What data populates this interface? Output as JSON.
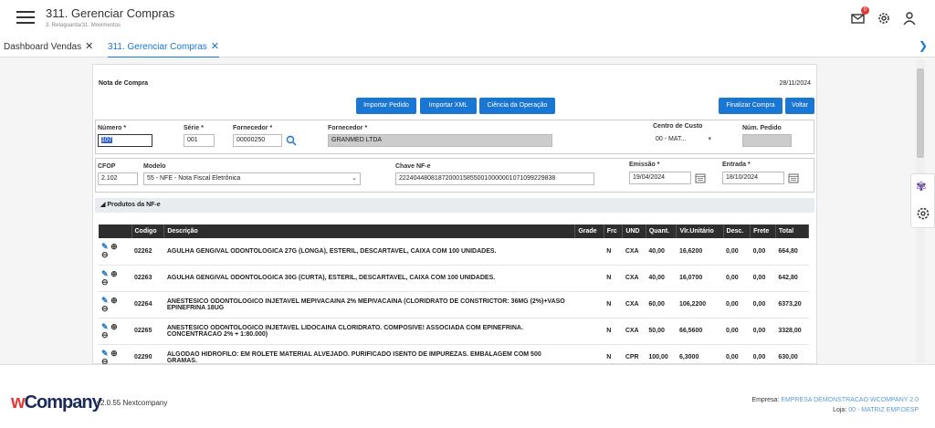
{
  "header": {
    "title": "311. Gerenciar Compras",
    "breadcrumb": "3. Retaguarda/31. Movimentos",
    "mail_badge": "0"
  },
  "tabs": [
    {
      "label": "Dashboard Vendas"
    },
    {
      "label": "311. Gerenciar Compras"
    }
  ],
  "panel": {
    "title": "Nota de Compra",
    "date": "28/11/2024"
  },
  "buttons": {
    "importar_pedido": "Importar Pedido",
    "importar_xml": "Importar XML",
    "ciencia": "Ciência da Operação",
    "finalizar": "Finalizar Compra",
    "voltar": "Voltar"
  },
  "form": {
    "numero_label": "Número *",
    "numero_value": "107",
    "serie_label": "Série *",
    "serie_value": "001",
    "fornecedor_code_label": "Fornecedor *",
    "fornecedor_code_value": "00000250",
    "fornecedor_name_label": "Fornecedor *",
    "fornecedor_name_value": "GRANMED LTDA",
    "centro_label": "Centro de Custo",
    "centro_value": "00 - MAT...",
    "pedido_label": "Núm. Pedido",
    "cfop_label": "CFOP",
    "cfop_value": "2.102",
    "modelo_label": "Modelo",
    "modelo_value": "55 - NFE - Nota Fiscal Eletrônica",
    "chave_label": "Chave NF-e",
    "chave_value": "22240448081872000158550010000001071099229838",
    "emissao_label": "Emissão *",
    "emissao_value": "19/04/2024",
    "entrada_label": "Entrada *",
    "entrada_value": "18/10/2024"
  },
  "section": {
    "label": "Produtos da NF-e"
  },
  "table": {
    "headers": [
      "",
      "Codigo",
      "Descrição",
      "Grade",
      "Frc",
      "UND",
      "Quant.",
      "Vlr.Unitário",
      "Desc.",
      "Frete",
      "Total"
    ],
    "rows": [
      {
        "codigo": "02262",
        "descricao": "AGULHA GENGIVAL ODONTOLOGICA 27G (LONGA), ESTERIL, DESCARTAVEL, CAIXA COM 100 UNIDADES.",
        "grade": "",
        "frc": "N",
        "und": "CXA",
        "quant": "40,00",
        "vlr": "16,6200",
        "desc": "0,00",
        "frete": "0,00",
        "total": "664,80"
      },
      {
        "codigo": "02263",
        "descricao": "AGULHA GENGIVAL ODONTOLOGICA 30G (CURTA), ESTERIL, DESCARTAVEL, CAIXA COM 100 UNIDADES.",
        "grade": "",
        "frc": "N",
        "und": "CXA",
        "quant": "40,00",
        "vlr": "16,0700",
        "desc": "0,00",
        "frete": "0,00",
        "total": "642,80"
      },
      {
        "codigo": "02264",
        "descricao": "ANESTESICO ODONTOLOGICO INJETAVEL MEPIVACAINA 2% MEPIVACAINA (CLORIDRATO DE CONSTRICTOR: 36MG (2%)+VASO EPINEFRINA 18UG",
        "grade": "",
        "frc": "N",
        "und": "CXA",
        "quant": "60,00",
        "vlr": "106,2200",
        "desc": "0,00",
        "frete": "0,00",
        "total": "6373,20"
      },
      {
        "codigo": "02265",
        "descricao": "ANESTESICO ODONTOLOGICO INJETAVEL LIDOCAINA CLORIDRATO. COMPOSIVE! ASSOCIADA COM EPINEFRINA. CONCENTRACAO 2% + 1:80.000)",
        "grade": "",
        "frc": "N",
        "und": "CXA",
        "quant": "50,00",
        "vlr": "66,5600",
        "desc": "0,00",
        "frete": "0,00",
        "total": "3328,00"
      },
      {
        "codigo": "02290",
        "descricao": "ALGODAO HIDROFILO: EM ROLETE MATERIAL ALVEJADO. PURIFICADO ISENTO DE IMPUREZAS. EMBALAGEM COM 500 GRAMAS.",
        "grade": "",
        "frc": "N",
        "und": "CPR",
        "quant": "100,00",
        "vlr": "6,3000",
        "desc": "0,00",
        "frete": "0,00",
        "total": "630,00"
      }
    ]
  },
  "footer": {
    "logo_w": "w",
    "logo_rest": "Company",
    "version": "v2.0.55 Nextcompany",
    "empresa_label": "Empresa:",
    "empresa_value": "EMPRESA DEMONSTRACAO WCOMPANY 2.0",
    "loja_label": "Loja:",
    "loja_value": "00 - MATRIZ EMP.DESP"
  }
}
